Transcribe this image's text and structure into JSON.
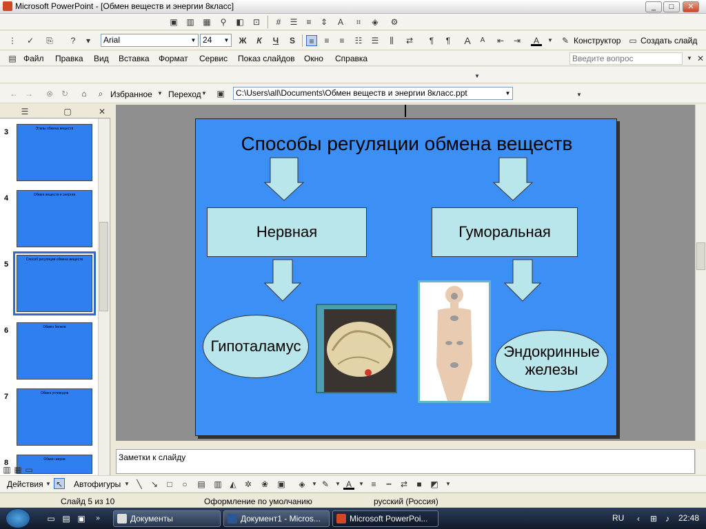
{
  "window": {
    "title": "Microsoft PowerPoint - [Обмен веществ и энергии 8класс]"
  },
  "format_toolbar": {
    "font": "Arial",
    "size": "24",
    "bold": "Ж",
    "italic": "К",
    "underline": "Ч",
    "shadow": "S",
    "design_label": "Конструктор",
    "new_slide_label": "Создать слайд"
  },
  "menu": {
    "items": [
      "Файл",
      "Правка",
      "Вид",
      "Вставка",
      "Формат",
      "Сервис",
      "Показ слайдов",
      "Окно",
      "Справка"
    ],
    "help_placeholder": "Введите вопрос"
  },
  "web_toolbar": {
    "favorites": "Избранное",
    "goto": "Переход",
    "address": "C:\\Users\\all\\Documents\\Обмен веществ и энергии 8класс.ppt"
  },
  "slides_panel": {
    "thumbnails": [
      {
        "num": "3",
        "caption": "Этапы обмена веществ"
      },
      {
        "num": "4",
        "caption": "Обмен веществ и энергии"
      },
      {
        "num": "5",
        "caption": "Способ регуляции обмена веществ"
      },
      {
        "num": "6",
        "caption": "Обмен белков"
      },
      {
        "num": "7",
        "caption": "Обмен углеводов"
      },
      {
        "num": "8",
        "caption": "Обмен жиров"
      }
    ],
    "selected": "5"
  },
  "slide": {
    "title": "Способы регуляции обмена веществ",
    "nervous": "Нервная",
    "humoral": "Гуморальная",
    "hypothalamus": "Гипоталамус",
    "endocrine": "Эндокринные железы"
  },
  "notes": {
    "placeholder": "Заметки к слайду"
  },
  "draw_toolbar": {
    "actions": "Действия",
    "autoshapes": "Автофигуры"
  },
  "status": {
    "slide": "Слайд 5 из 10",
    "design": "Оформление по умолчанию",
    "language": "русский (Россия)"
  },
  "taskbar": {
    "items": [
      "Документы",
      "Документ1 - Micros...",
      "Microsoft PowerPoi..."
    ],
    "lang": "RU",
    "time": "22:48"
  },
  "colors": {
    "slide_bg": "#3b8ff5",
    "shape_fill": "#b8e6ea"
  }
}
